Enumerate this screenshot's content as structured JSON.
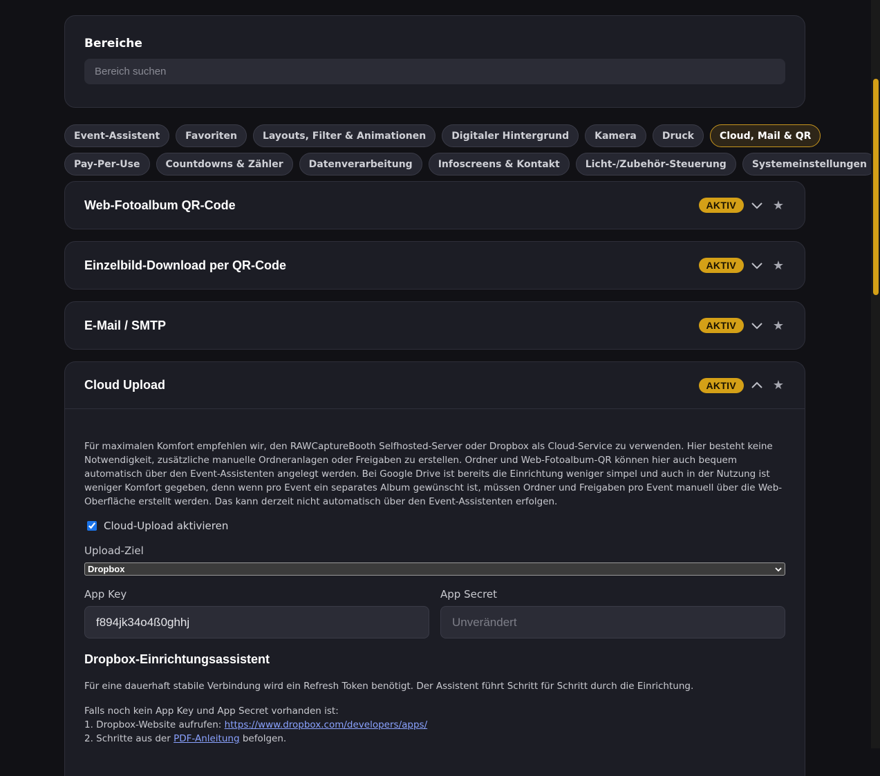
{
  "search": {
    "title": "Bereiche",
    "placeholder": "Bereich suchen"
  },
  "chips": {
    "row1": [
      "Event-Assistent",
      "Favoriten",
      "Layouts, Filter & Animationen",
      "Digitaler Hintergrund",
      "Kamera",
      "Druck",
      "Cloud, Mail & QR"
    ],
    "row2": [
      "Pay-Per-Use",
      "Countdowns & Zähler",
      "Datenverarbeitung",
      "Infoscreens & Kontakt",
      "Licht-/Zubehör-Steuerung",
      "Systemeinstellungen"
    ],
    "active": "Cloud, Mail & QR"
  },
  "sections": [
    {
      "title": "Web-Fotoalbum QR-Code",
      "badge": "AKTIV",
      "expanded": false
    },
    {
      "title": "Einzelbild-Download per QR-Code",
      "badge": "AKTIV",
      "expanded": false
    },
    {
      "title": "E-Mail / SMTP",
      "badge": "AKTIV",
      "expanded": false
    },
    {
      "title": "Cloud Upload",
      "badge": "AKTIV",
      "expanded": true
    }
  ],
  "cloud": {
    "description": "Für maximalen Komfort empfehlen wir, den RAWCaptureBooth Selfhosted-Server oder Dropbox als Cloud-Service zu verwenden. Hier besteht keine Notwendigkeit, zusätzliche manuelle Ordneranlagen oder Freigaben zu erstellen. Ordner und Web-Fotoalbum-QR können hier auch bequem automatisch über den Event-Assistenten angelegt werden. Bei Google Drive ist bereits die Einrichtung weniger simpel und auch in der Nutzung ist weniger Komfort gegeben, denn wenn pro Event ein separates Album gewünscht ist, müssen Ordner und Freigaben pro Event manuell über die Web-Oberfläche erstellt werden. Das kann derzeit nicht automatisch über den Event-Assistenten erfolgen.",
    "enable_label": "Cloud-Upload aktivieren",
    "enabled": true,
    "target_label": "Upload-Ziel",
    "target_value": "Dropbox",
    "app_key_label": "App Key",
    "app_key_value": "f894jk34o4ß0ghhj",
    "app_secret_label": "App Secret",
    "app_secret_placeholder": "Unverändert",
    "wizard_title": "Dropbox-Einrichtungsassistent",
    "wizard_intro": "Für eine dauerhaft stabile Verbindung wird ein Refresh Token benötigt. Der Assistent führt Schritt für Schritt durch die Einrichtung.",
    "steps_intro": "Falls noch kein App Key und App Secret vorhanden ist:",
    "step1_prefix": "1. Dropbox-Website aufrufen: ",
    "step1_link": "https://www.dropbox.com/developers/apps/",
    "step2_prefix": "2. Schritte aus der ",
    "step2_link": "PDF-Anleitung",
    "step2_suffix": " befolgen."
  },
  "colors": {
    "accent": "#d4a017",
    "background": "#111115",
    "card": "#1c1d25",
    "link": "#8aa2ff"
  },
  "icons": {
    "collapsed": "chevron-down-icon",
    "expanded": "chevron-up-icon",
    "favorite": "star-icon"
  }
}
